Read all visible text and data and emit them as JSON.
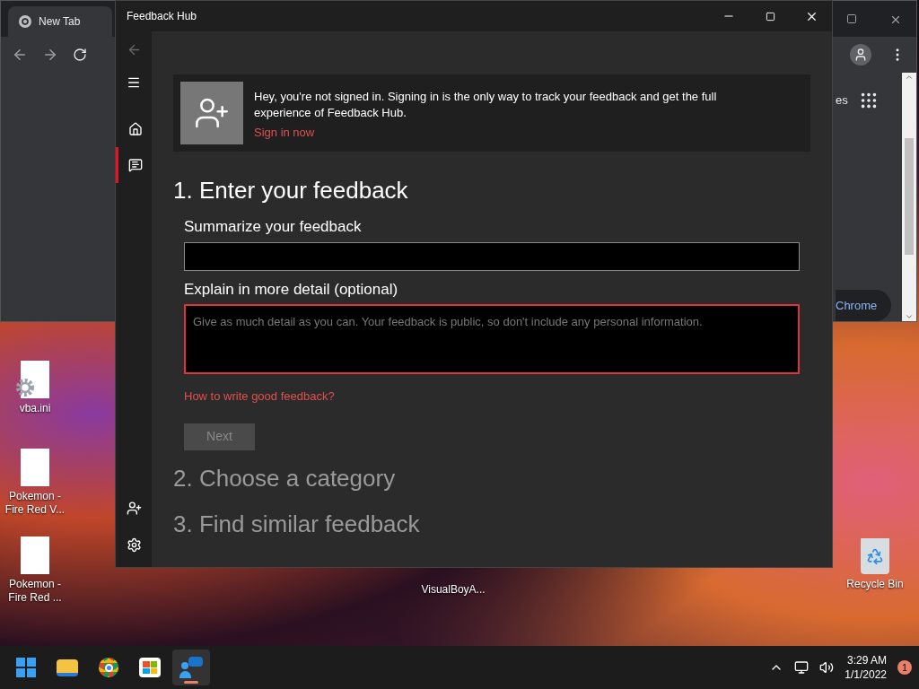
{
  "desktop": {
    "icons": [
      {
        "label": "vba.ini",
        "kind": "settings-file"
      },
      {
        "label": "Pokemon - Fire Red V...",
        "kind": "file"
      },
      {
        "label": "Pokemon - Fire Red ...",
        "kind": "file"
      },
      {
        "label": "VisualBoyA...",
        "kind": "label-only"
      },
      {
        "label": "Recycle Bin",
        "kind": "recycle"
      }
    ]
  },
  "browser": {
    "tab": "New Tab",
    "partial_text": "es",
    "button": "Chrome"
  },
  "window": {
    "title": "Feedback Hub",
    "nav": [
      {
        "kind": "home",
        "selected": false
      },
      {
        "kind": "feedback",
        "selected": true
      }
    ],
    "banner": {
      "message": "Hey, you're not signed in. Signing in is the only way to track your feedback and get the full experience of Feedback Hub.",
      "link": "Sign in now"
    },
    "steps": [
      {
        "heading": "1. Enter your feedback",
        "expanded": true
      },
      {
        "heading": "2. Choose a category",
        "expanded": false
      },
      {
        "heading": "3. Find similar feedback",
        "expanded": false
      }
    ],
    "form": {
      "summary_label": "Summarize your feedback",
      "detail_label": "Explain in more detail (optional)",
      "detail_placeholder": "Give as much detail as you can. Your feedback is public, so don't include any personal information.",
      "detail_focused": true,
      "help_link": "How to write good feedback?",
      "next_button": "Next",
      "next_disabled": true
    }
  },
  "taskbar": {
    "apps": [
      {
        "kind": "start",
        "selected": false
      },
      {
        "kind": "explorer",
        "selected": false
      },
      {
        "kind": "chrome",
        "selected": false
      },
      {
        "kind": "store",
        "selected": false
      },
      {
        "kind": "feedback",
        "selected": true
      }
    ],
    "time": "3:29 AM",
    "date": "1/1/2022",
    "notifications": "1"
  }
}
